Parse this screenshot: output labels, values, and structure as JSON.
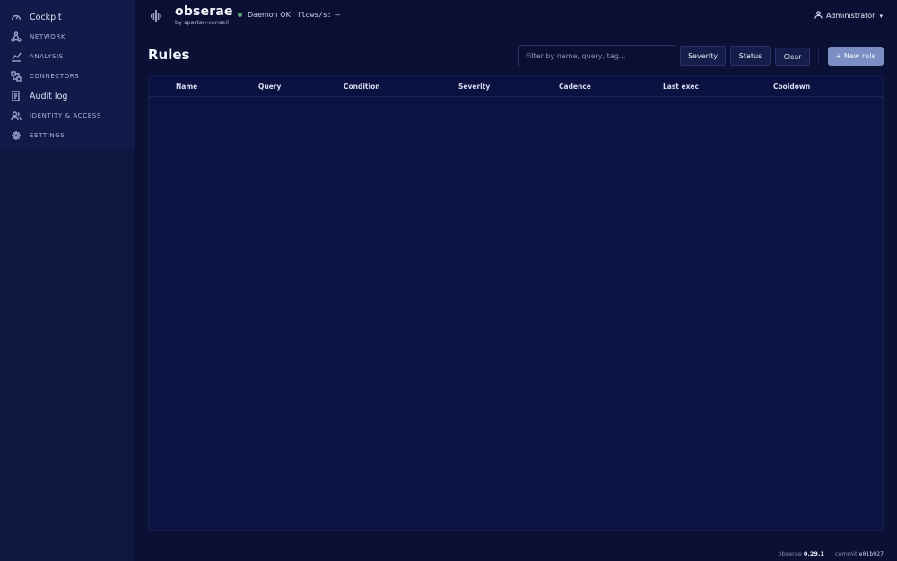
{
  "brand": {
    "title": "obserae",
    "subtitle": "by spartan-conseil"
  },
  "status": {
    "daemon": "Daemon OK",
    "flows": "flows/s: —",
    "dot_color": "#5fa36b"
  },
  "user": {
    "name": "Administrator",
    "caret": "▾"
  },
  "sidebar": {
    "items": [
      {
        "label": "Cockpit",
        "icon": "gauge-icon"
      },
      {
        "label": "NETWORK",
        "icon": "network-icon"
      },
      {
        "label": "ANALYSIS",
        "icon": "analysis-icon"
      },
      {
        "label": "CONNECTORS",
        "icon": "connectors-icon"
      },
      {
        "label": "Audit log",
        "icon": "audit-log-icon"
      },
      {
        "label": "IDENTITY & ACCESS",
        "icon": "users-icon"
      },
      {
        "label": "SETTINGS",
        "icon": "gear-icon"
      }
    ]
  },
  "page": {
    "title": "Rules"
  },
  "toolbar": {
    "filter_placeholder": "Filter by name, query, tag...",
    "severity_label": "Severity",
    "status_label": "Status",
    "clear_label": "Clear",
    "new_rule_label": "+ New rule"
  },
  "table": {
    "columns": [
      "Name",
      "Query",
      "Condition",
      "Severity",
      "Cadence",
      "Last exec",
      "Cooldown"
    ],
    "rows": []
  },
  "footer": {
    "app": "obserae",
    "version": "0.29.1",
    "commit_label": "commit",
    "commit": "e01b927"
  },
  "colors": {
    "accent": "#7b8fc4",
    "background": "#0b1035",
    "sidebar": "#111a48"
  }
}
